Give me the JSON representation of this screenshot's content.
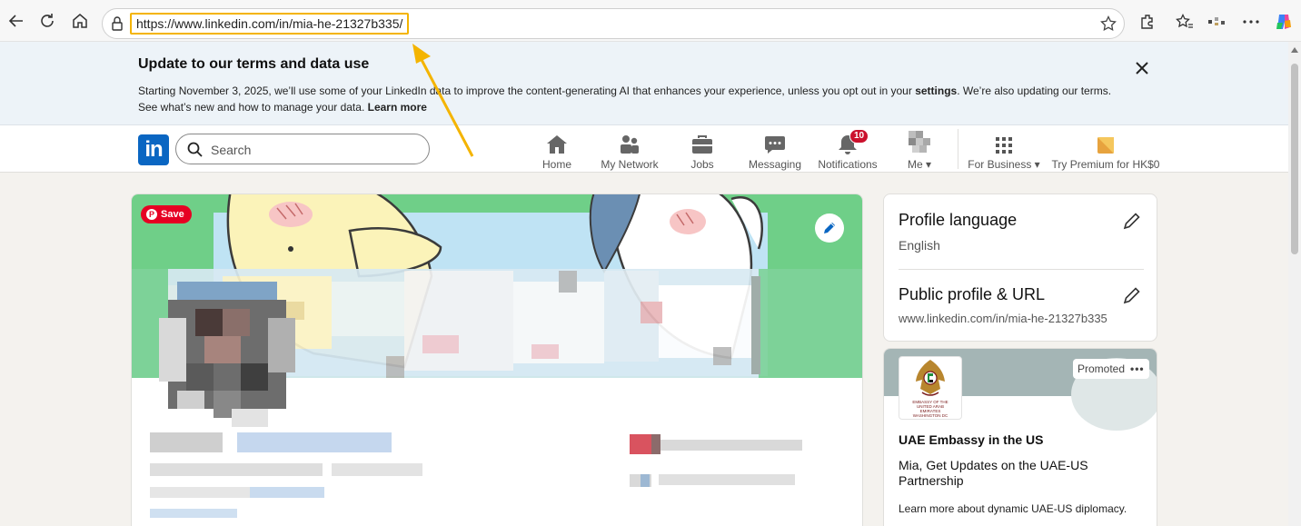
{
  "browser": {
    "url": "https://www.linkedin.com/in/mia-he-21327b335/"
  },
  "notice": {
    "title": "Update to our terms and data use",
    "line1_prefix": "Starting November 3, 2025, we’ll use some of your LinkedIn data to improve the content-generating AI that enhances your experience, unless you opt out in your ",
    "line1_link": "settings",
    "line1_suffix": ". We’re also updating our terms.",
    "line2_prefix": "See what’s new and how to manage your data. ",
    "line2_link": "Learn more"
  },
  "header": {
    "logo_text": "in",
    "search_placeholder": "Search",
    "nav": {
      "home": "Home",
      "network": "My Network",
      "jobs": "Jobs",
      "messaging": "Messaging",
      "notifications": "Notifications",
      "notifications_count": "10",
      "me": "Me",
      "business": "For Business",
      "premium": "Try Premium for HK$0"
    }
  },
  "profile": {
    "save_label": "Save"
  },
  "sidebar": {
    "language_title": "Profile language",
    "language_value": "English",
    "url_title": "Public profile & URL",
    "url_value": "www.linkedin.com/in/mia-he-21327b335"
  },
  "ad": {
    "promoted_label": "Promoted",
    "logo_caption": "EMBASSY OF THE UNITED ARAB EMIRATES WASHINGTON DC",
    "name": "UAE Embassy in the US",
    "message": "Mia, Get Updates on the UAE-US Partnership",
    "description": "Learn more about dynamic UAE-US diplomacy."
  },
  "colors": {
    "linkedin_blue": "#0a66c2",
    "annotation": "#f4b400",
    "pinterest_red": "#e60023",
    "badge_red": "#cb112d"
  }
}
